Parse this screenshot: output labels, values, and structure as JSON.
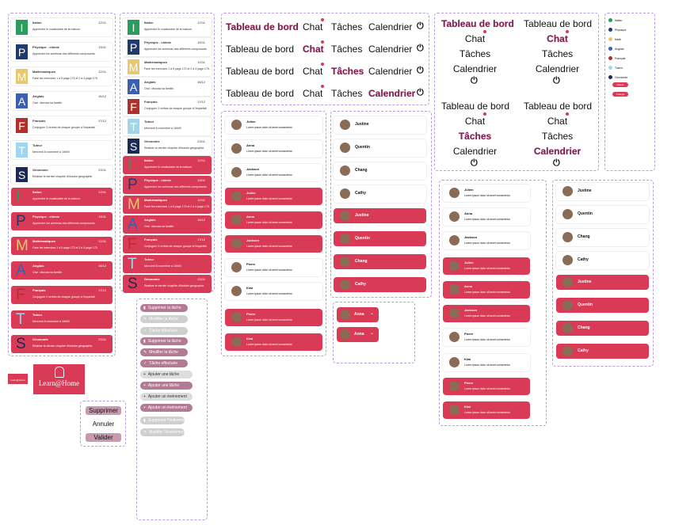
{
  "colors": {
    "accent": "#d93a55",
    "plum": "#7a1f52",
    "frame": "#b89be0"
  },
  "subjects": [
    {
      "letter": "I",
      "name": "Italien",
      "desc": "Apprendre le vocabulaire de la maison.",
      "date": "12/11",
      "color": "#2a9d5c"
    },
    {
      "letter": "P",
      "name": "Physique - chimie",
      "desc": "Apprendre les schémas des différents composants.",
      "date": "15/11",
      "color": "#1e3a6e"
    },
    {
      "letter": "M",
      "name": "Mathématiques",
      "desc": "Faire les exercices 1 à 5 page 173 et 2 à 4 page 175.",
      "date": "12/11",
      "color": "#e8c86e"
    },
    {
      "letter": "A",
      "name": "Anglais",
      "desc": "Oral : discuss sa famille.",
      "date": "16/12",
      "color": "#3c5fb0"
    },
    {
      "letter": "F",
      "name": "Français",
      "desc": "Conjuguer 3 verbes de chaque groupe à l'imparfait.",
      "date": "17/12",
      "color": "#b0302c"
    },
    {
      "letter": "T",
      "name": "Tuteur",
      "desc": "Mercredi 8 novembre à 16h00",
      "date": "",
      "color": "#9fd6ee"
    },
    {
      "letter": "S",
      "name": "Géonomie",
      "desc": "Réaliser le dernier chapitre d'histoire géographie.",
      "date": "23/11",
      "color": "#1b2a55"
    }
  ],
  "nav": {
    "dashboard": "Tableau de bord",
    "chat": "Chat",
    "tasks": "Tâches",
    "calendar": "Calendrier",
    "power": "⏻"
  },
  "contacts_msg": [
    "Julien",
    "Anna",
    "Jackson",
    "Julien",
    "Anna",
    "Jackson",
    "Pierre",
    "Kiwi",
    "Pierre",
    "Kiwi"
  ],
  "lorem": "Lorem ipsum dolor sit amet consectetur.",
  "names2": [
    "Justine",
    "Quentin",
    "Chang",
    "Cathy",
    "Justine",
    "Quentin",
    "Chang",
    "Cathy"
  ],
  "dropdown": [
    "Anna",
    "Anna"
  ],
  "actions": [
    "Supprimer la tâche",
    "Modifier la tâche",
    "Tâche effectuée",
    "Supprimer la tâche",
    "Modifier la tâche",
    "Tâche effectuée",
    "Ajouter une tâche",
    "Ajouter une tâche",
    "Ajouter un événement",
    "Ajouter un événement",
    "Supprimer l'événement",
    "Modifier l'événement"
  ],
  "dialog": {
    "delete": "Supprimer",
    "cancel": "Annuler",
    "validate": "Valider"
  },
  "logo": {
    "name": "Learn@Home",
    "small": "Learn@Home"
  },
  "mini": [
    "Italien",
    "Physique",
    "Math",
    "Anglais",
    "Français",
    "Tuteur",
    "Géonomie"
  ],
  "mini_buttons": [
    "Delete",
    "Change"
  ]
}
